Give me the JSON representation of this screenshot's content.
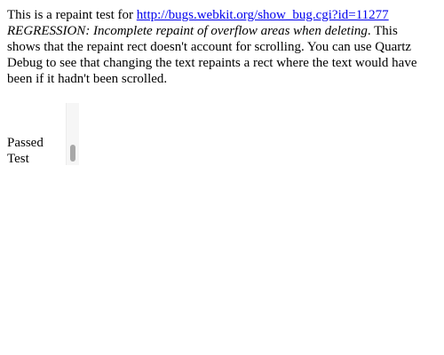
{
  "description": {
    "intro": "This is a repaint test for ",
    "bug_link": "http://bugs.webkit.org/show_bug.cgi?id=11277",
    "bug_title": "REGRESSION: Incomplete repaint of overflow areas when deleting",
    "body": ". This shows that the repaint rect doesn't account for scrolling. You can use Quartz Debug to see that changing the text repaints a rect where the text would have been if it hadn't been scrolled."
  },
  "overflow_box": {
    "result_line1": "Passed",
    "result_line2": "Test"
  },
  "colors": {
    "link": "#0000ee",
    "scrollbar_track": "#f6f6f6",
    "scrollbar_thumb": "#a8a8a8"
  }
}
